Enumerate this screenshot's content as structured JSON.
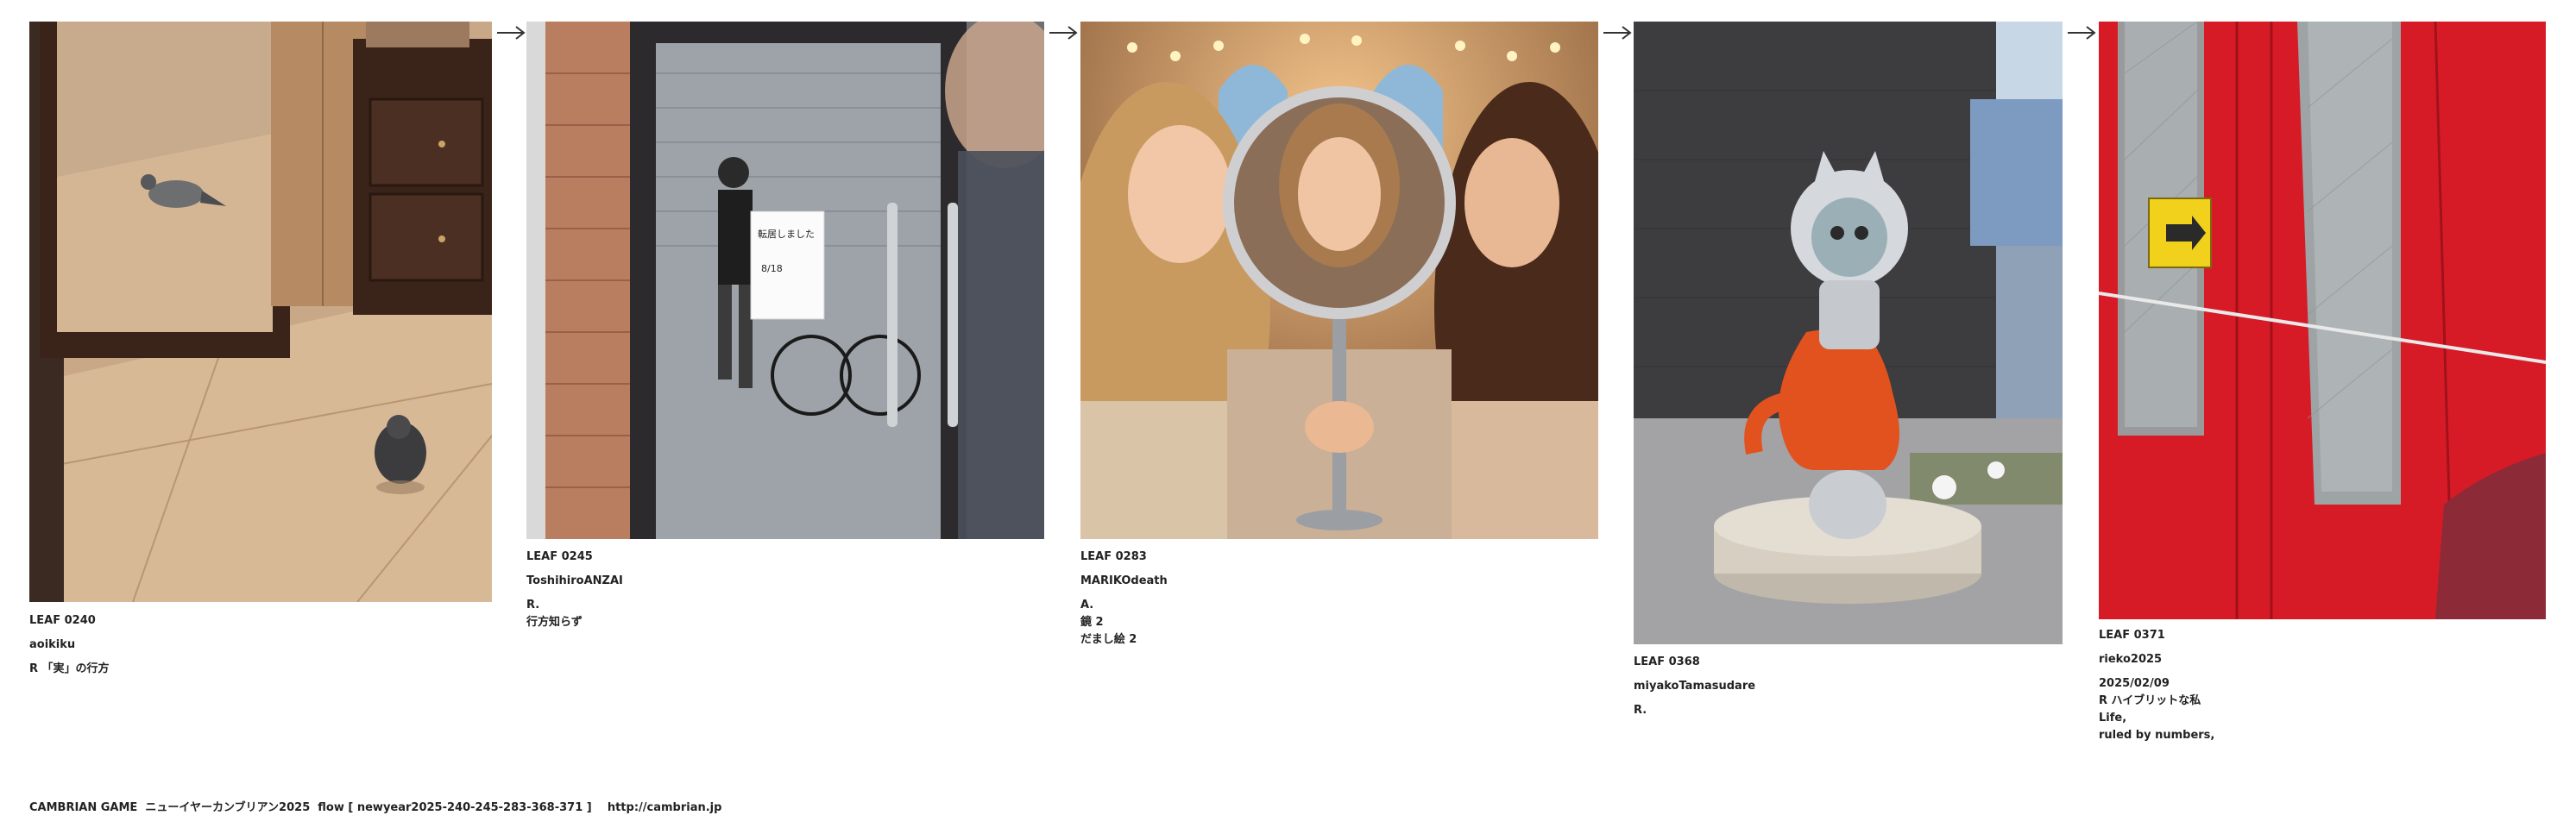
{
  "leaves": [
    {
      "id": "LEAF 0240",
      "author": "aoikiku",
      "lines": [
        "R 「実」の行方"
      ],
      "note": []
    },
    {
      "id": "LEAF 0245",
      "author": "ToshihiroANZAI",
      "lines": [
        "R.",
        "行方知らず"
      ],
      "note": []
    },
    {
      "id": "LEAF 0283",
      "author": "MARIKOdeath",
      "lines": [
        "A.",
        "鏡 2",
        "だまし絵 2"
      ],
      "note": []
    },
    {
      "id": "LEAF 0368",
      "author": "miyakoTamasudare",
      "lines": [
        "R."
      ],
      "note": []
    },
    {
      "id": "LEAF 0371",
      "author": "rieko2025",
      "lines": [
        "2025/02/09",
        "R ハイブリットな私",
        "Life,",
        "ruled by numbers,"
      ],
      "note": []
    }
  ],
  "image_labels": {
    "sign_text": "転居しました",
    "sign_sub": "8/18"
  },
  "footer": {
    "text": "CAMBRIAN GAME  ニューイヤーカンブリアン2025  flow [ newyear2025-240-245-283-368-371 ]    http://cambrian.jp"
  },
  "icons": {
    "arrow": "right-arrow-icon"
  }
}
